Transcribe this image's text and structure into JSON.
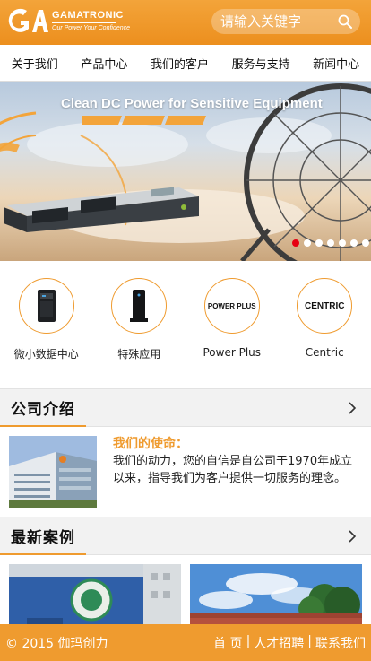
{
  "header": {
    "logo_name": "GAMATRONIC",
    "logo_slogan": "Our Power Your Confidence",
    "search_placeholder": "请输入关键字",
    "search_icon": "search-icon",
    "brand_color": "#ef9b2f"
  },
  "nav": {
    "items": [
      {
        "label": "关于我们"
      },
      {
        "label": "产品中心"
      },
      {
        "label": "我们的客户"
      },
      {
        "label": "服务与支持"
      },
      {
        "label": "新闻中心"
      }
    ]
  },
  "banner": {
    "title": "Clean DC Power for Sensitive Equipment",
    "slide_count": 7,
    "active_slide": 1
  },
  "categories": [
    {
      "label": "微小数据中心",
      "icon": "server-tower-icon"
    },
    {
      "label": "特殊应用",
      "icon": "ups-unit-icon"
    },
    {
      "label": "Power Plus",
      "icon_text": "POWER PLUS"
    },
    {
      "label": "Centric",
      "icon_text": "CENTRIC"
    }
  ],
  "about": {
    "section_title": "公司介绍",
    "heading": "我们的使命：",
    "body": "我们的动力，您的自信是自公司于1970年成立以来，指导我们为客户提供一切服务的理念。"
  },
  "cases": {
    "section_title": "最新案例"
  },
  "footer": {
    "copyright": "© 2015 伽玛创力",
    "links": [
      "首 页",
      "人才招聘",
      "联系我们"
    ],
    "separator": "|"
  }
}
